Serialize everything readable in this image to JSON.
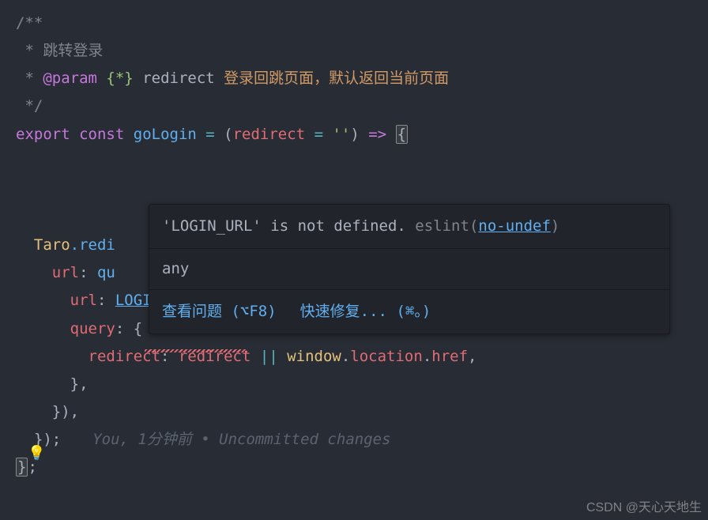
{
  "code": {
    "doc_open": "/**",
    "doc_line1_star": " * ",
    "doc_line1_text": "跳转登录",
    "doc_line2_star": " * ",
    "doc_tag": "@param",
    "doc_type": "{*}",
    "doc_param_name": "redirect",
    "doc_desc": "登录回跳页面，默认返回当前页面",
    "doc_close": " */",
    "export_kw": "export",
    "const_kw": "const",
    "fn_name": "goLogin",
    "equals": " = ",
    "open_paren": "(",
    "param_name": "redirect",
    "param_default_eq": " = ",
    "param_default_val": "''",
    "close_paren": ")",
    "arrow": " => ",
    "open_brace": "{",
    "taro": "Taro",
    "redi": ".redi",
    "url_prop": "url",
    "qu_text": "qu",
    "login_url": "LOGIN_URL",
    "query_prop": "query",
    "redirect_prop": "redirect",
    "redirect_ref": "redirect",
    "or": " || ",
    "window": "window",
    "location": "location",
    "href": "href",
    "close_inner": "},",
    "close_paren_braces": "}),",
    "close_outer": "});",
    "close_fn": "};"
  },
  "popup": {
    "error_prefix": "'LOGIN_URL' is not defined. ",
    "eslint_label": "eslint",
    "rule": "no-undef",
    "type_info": "any",
    "action_view": "查看问题",
    "shortcut_view": "(⌥F8)",
    "action_fix": "快速修复...",
    "shortcut_fix": "(⌘。)"
  },
  "gitlens": {
    "text": "You, 1分钟前 • Uncommitted changes"
  },
  "watermark": "CSDN @天心天地生",
  "bulb": "💡"
}
